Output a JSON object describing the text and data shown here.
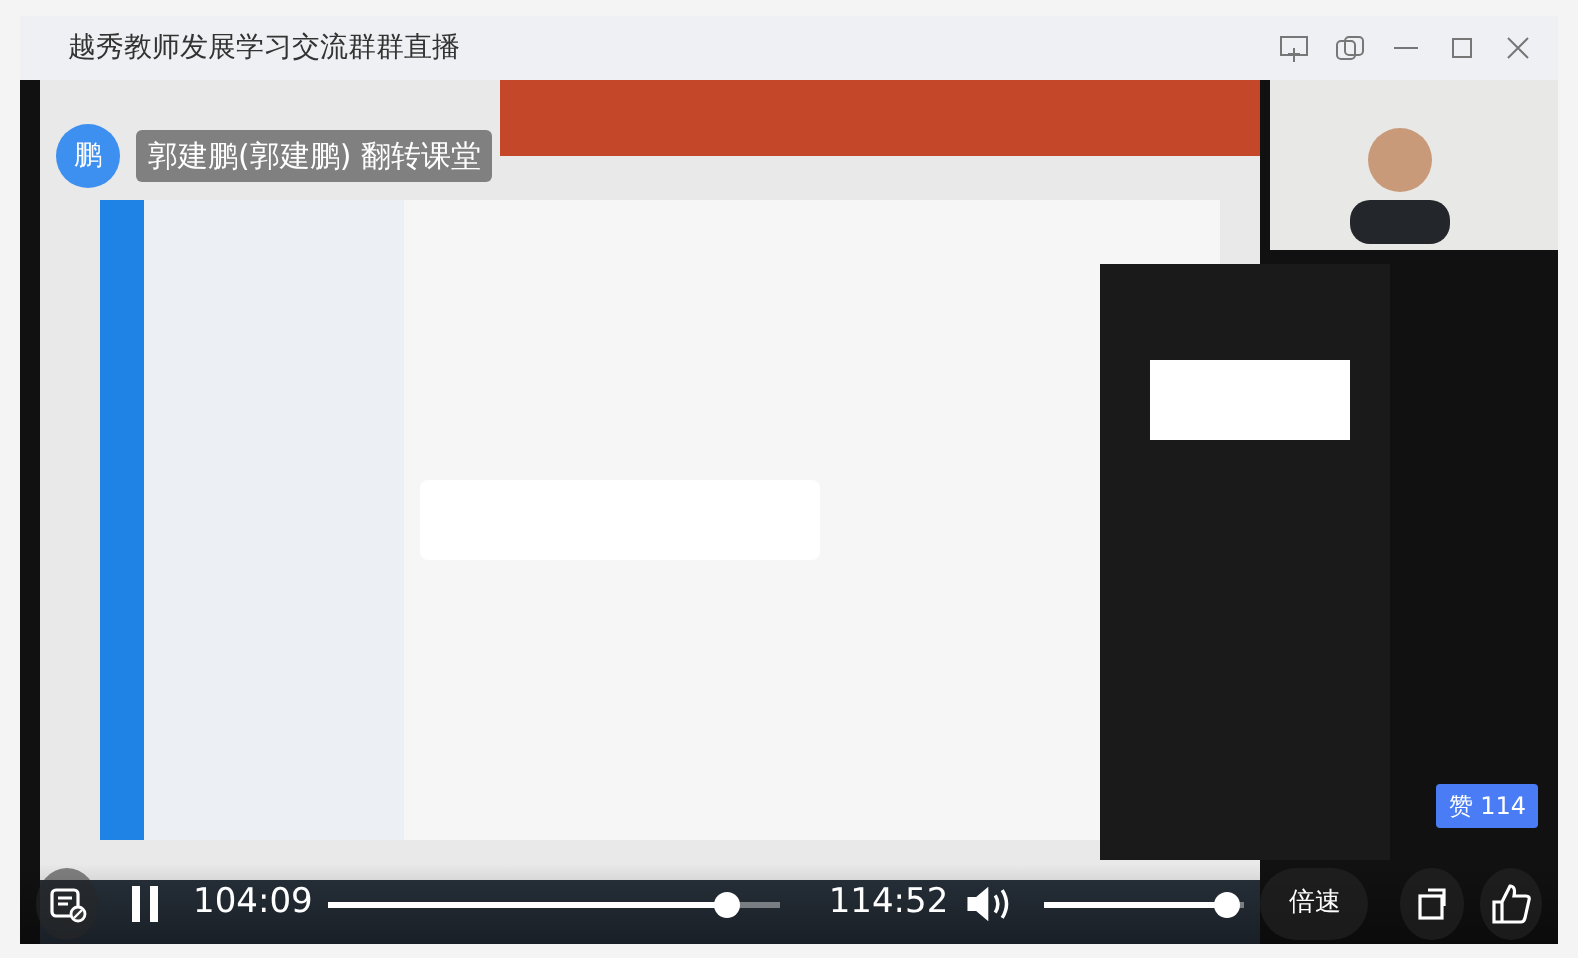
{
  "window": {
    "title": "越秀教师发展学习交流群群直播"
  },
  "presenter": {
    "avatar": "鹏",
    "name": "郭建鹏(郭建鹏) 翻转课堂"
  },
  "likes": {
    "label": "赞",
    "count": "114"
  },
  "player": {
    "playing": true,
    "elapsed": "104:09",
    "duration": "114:52",
    "progress": {
      "level": 0.906
    },
    "volume": {
      "level": 0.97
    },
    "speed_button": "倍速"
  }
}
